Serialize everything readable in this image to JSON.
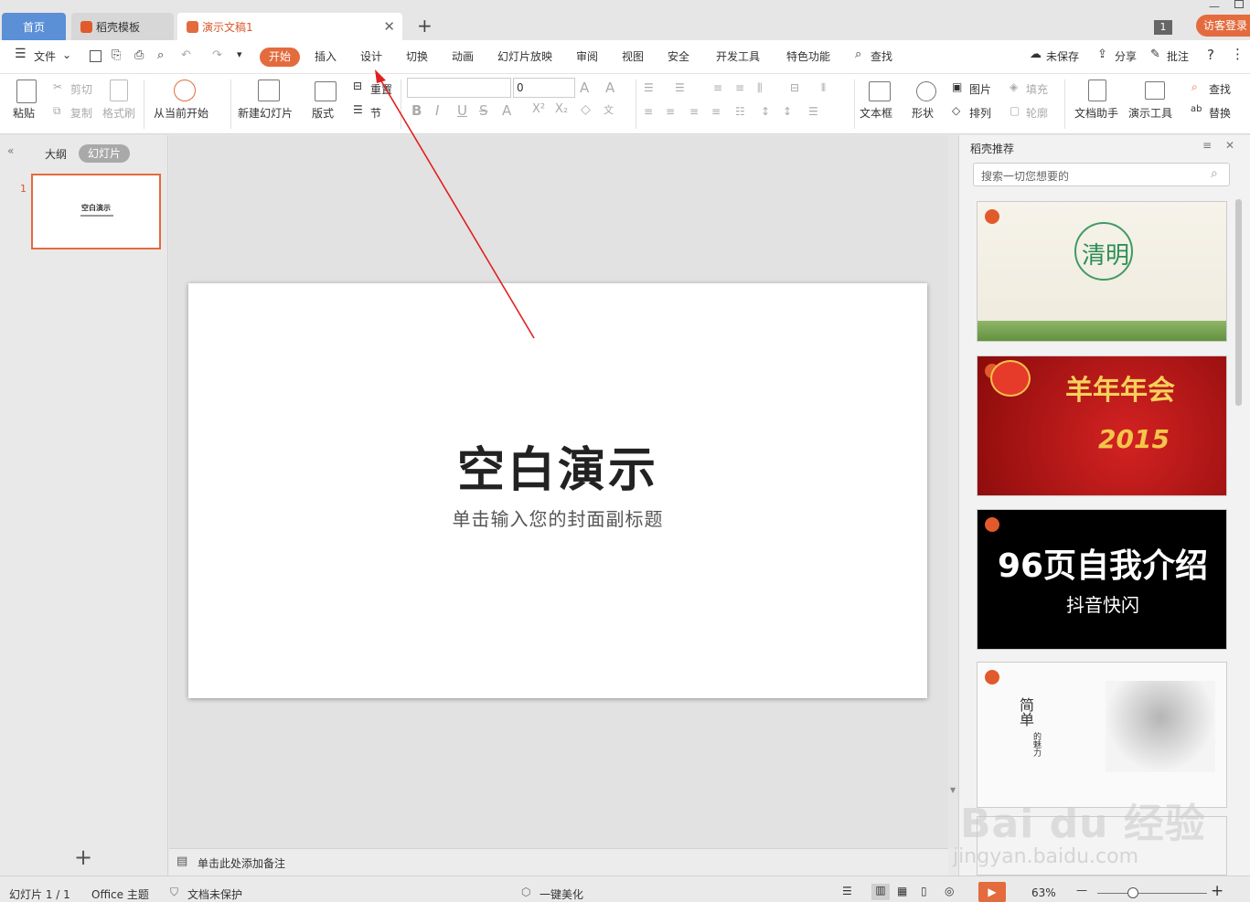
{
  "tabs": {
    "home": "首页",
    "daoke": "稻壳模板",
    "doc": "演示文稿1",
    "page_num": "1",
    "visitor": "访客登录"
  },
  "menu": {
    "file": "文件",
    "items": [
      "开始",
      "插入",
      "设计",
      "切换",
      "动画",
      "幻灯片放映",
      "审阅",
      "视图",
      "安全",
      "开发工具",
      "特色功能"
    ],
    "search": "查找",
    "unsaved": "未保存",
    "share": "分享",
    "comment": "批注",
    "help": "?"
  },
  "ribbon": {
    "paste": "粘贴",
    "cut": "剪切",
    "copy": "复制",
    "format_painter": "格式刷",
    "from_current": "从当前开始",
    "new_slide": "新建幻灯片",
    "layout": "版式",
    "reset": "重置",
    "section": "节",
    "font_size": "0",
    "textbox": "文本框",
    "shape": "形状",
    "picture": "图片",
    "fill": "填充",
    "arrange": "排列",
    "outline": "轮廓",
    "doc_helper": "文档助手",
    "present_tools": "演示工具",
    "find": "查找",
    "replace": "替换"
  },
  "left": {
    "outline": "大纲",
    "slides": "幻灯片",
    "slide_index": "1",
    "thumb_title": "空白演示"
  },
  "slide": {
    "title": "空白演示",
    "subtitle": "单击输入您的封面副标题"
  },
  "notes": {
    "placeholder": "单击此处添加备注"
  },
  "right": {
    "title": "稻壳推荐",
    "search_placeholder": "搜索一切您想要的",
    "templates": [
      {
        "name": "qingming",
        "text": "清明"
      },
      {
        "name": "nianhui",
        "text": "羊年年会",
        "sub": "2015"
      },
      {
        "name": "self-intro",
        "text": "96页自我介绍",
        "sub": "抖音快闪"
      },
      {
        "name": "jiandan",
        "text": "简单",
        "sub": "的魅力"
      }
    ]
  },
  "status": {
    "slide_count": "幻灯片 1 / 1",
    "theme": "Office 主题",
    "protect": "文档未保护",
    "beautify": "一键美化",
    "zoom": "63%"
  },
  "watermark": {
    "text": "Bai du 经验",
    "url": "jingyan.baidu.com"
  },
  "colors": {
    "accent": "#e36b3d",
    "tab_blue": "#5b8fd6",
    "arrow": "#e02020"
  }
}
